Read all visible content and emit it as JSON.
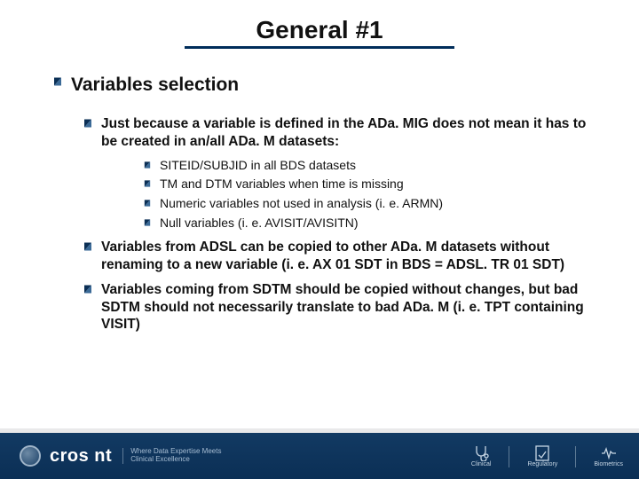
{
  "title": "General #1",
  "section": {
    "heading": "Variables selection",
    "items": [
      {
        "text": "Just because a variable is defined in the ADa. MIG does not mean it has to be created in an/all ADa. M datasets:",
        "sub": [
          "SITEID/SUBJID in all BDS datasets",
          "TM and DTM variables when time is missing",
          "Numeric variables not used in analysis (i. e. ARMN)",
          "Null variables (i. e. AVISIT/AVISITN)"
        ]
      },
      {
        "text": "Variables from ADSL can be copied to other ADa. M datasets without renaming to a new variable (i. e. AX 01 SDT in BDS = ADSL. TR 01 SDT)"
      },
      {
        "text": "Variables coming from SDTM should be copied without changes, but bad SDTM should not necessarily translate to bad ADa. M (i. e. TPT containing VISIT)"
      }
    ]
  },
  "footer": {
    "brand": "cros nt",
    "tagline1": "Where Data Expertise Meets",
    "tagline2": "Clinical Excellence",
    "cats": [
      "Clinical",
      "Regulatory",
      "Biometrics"
    ]
  }
}
